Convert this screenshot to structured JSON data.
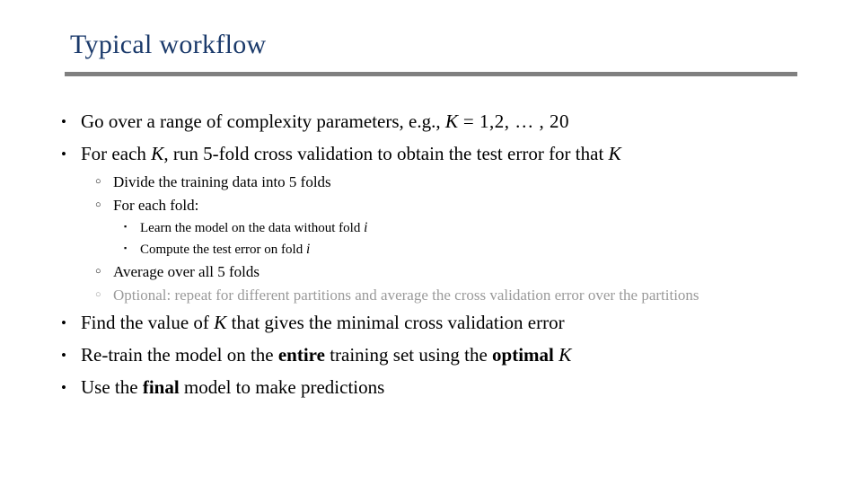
{
  "slide": {
    "title": "Typical workflow",
    "title_color": "#1b3a6b",
    "rule_color": "#808080",
    "background_color": "#ffffff",
    "muted_color": "#9a9a9a",
    "body_color": "#000000"
  },
  "markers": {
    "level1": "•",
    "level2": "○",
    "level3": "▪"
  },
  "content": {
    "b1": {
      "lead": "Go over a range of complexity parameters, e.g., ",
      "math_var": "K",
      "math_rest": " = 1,2, … , 20"
    },
    "b2": {
      "p1": "For each ",
      "var1": "K",
      "p2": ", run 5-fold cross validation to obtain the test error for that ",
      "var2": "K"
    },
    "b2s1": "Divide the training data into 5 folds",
    "b2s2": "For each fold:",
    "b2s2a": {
      "lead": "Learn the model on the data without fold ",
      "var": "i"
    },
    "b2s2b": {
      "lead": "Compute the test error on fold ",
      "var": "i"
    },
    "b2s3": "Average over all 5 folds",
    "b2s4": "Optional: repeat for different partitions and average the cross validation error over the partitions",
    "b3": {
      "p1": "Find the value of ",
      "var1": "K",
      "p2": " that gives the minimal cross validation error"
    },
    "b4": {
      "p1": "Re-train the model on the ",
      "bold1": "entire",
      "p2": " training set using the ",
      "bold2": "optimal",
      "p3": " ",
      "var1": "K"
    },
    "b5": {
      "p1": "Use the ",
      "bold1": "final",
      "p2": " model to make predictions"
    }
  }
}
